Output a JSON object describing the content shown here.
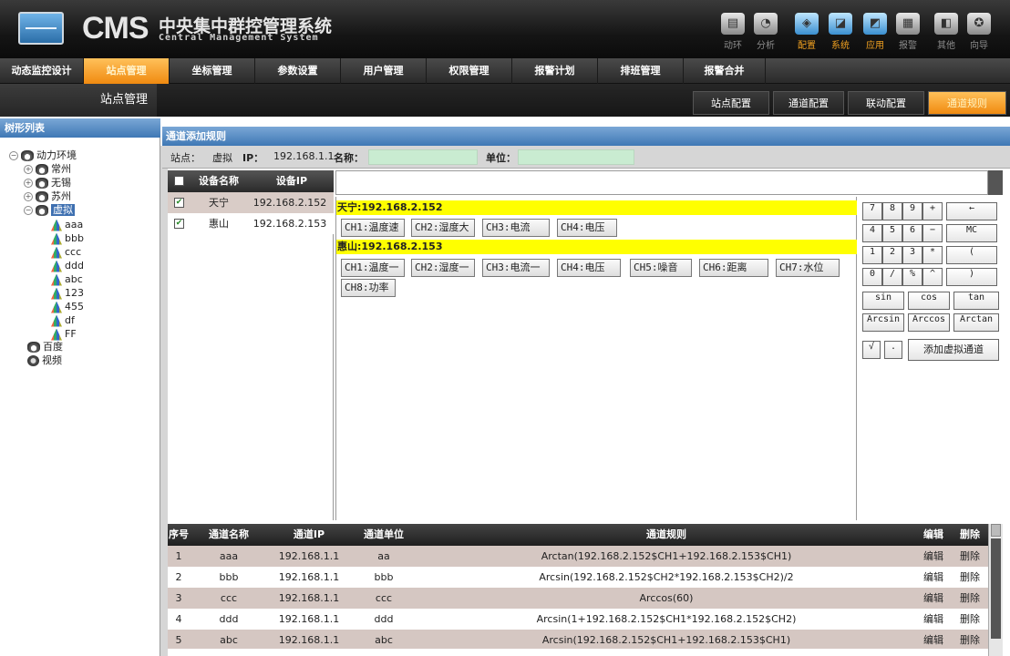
{
  "app": {
    "logo_text": "CMS",
    "title_cn": "中央集中群控管理系统",
    "title_en": "Central Management System"
  },
  "header_icons": [
    {
      "name": "env-icon",
      "label": "动环",
      "glyph": "▤"
    },
    {
      "name": "analysis-icon",
      "label": "分析",
      "glyph": "◔"
    },
    {
      "name": "config-icon",
      "label": "配置",
      "glyph": "◈",
      "active": true
    },
    {
      "name": "system-icon",
      "label": "系统",
      "glyph": "◪",
      "active": true
    },
    {
      "name": "apps-icon",
      "label": "应用",
      "glyph": "◩",
      "active": true
    },
    {
      "name": "alarm-icon",
      "label": "报警",
      "glyph": "▦"
    },
    {
      "name": "other-icon",
      "label": "其他",
      "glyph": "◧"
    },
    {
      "name": "wizard-icon",
      "label": "向导",
      "glyph": "✪"
    }
  ],
  "nav": [
    "动态监控设计",
    "站点管理",
    "坐标管理",
    "参数设置",
    "用户管理",
    "权限管理",
    "报警计划",
    "排班管理",
    "报警合并"
  ],
  "section_title": "站点管理",
  "subtabs": [
    "站点配置",
    "通道配置",
    "联动配置",
    "通道规则"
  ],
  "tree": {
    "title": "树形列表",
    "root": "动力环境",
    "cities": [
      "常州",
      "无锡",
      "苏州",
      "虚拟"
    ],
    "devices": [
      "aaa",
      "bbb",
      "ccc",
      "ddd",
      "abc",
      "123",
      "455",
      "df",
      "FF"
    ],
    "extra_site": "百度",
    "video": "视频"
  },
  "panel_title": "通道添加规则",
  "info": {
    "site_label": "站点：",
    "site_value": "虚拟",
    "ip_label": "IP：",
    "ip_value": "192.168.1.1",
    "name_label": "名称：",
    "name_value": "",
    "unit_label": "单位：",
    "unit_value": ""
  },
  "device_table": {
    "headers": [
      "设备名称",
      "设备IP"
    ],
    "rows": [
      {
        "name": "天宁",
        "ip": "192.168.2.152",
        "checked": true
      },
      {
        "name": "惠山",
        "ip": "192.168.2.153",
        "checked": true
      }
    ]
  },
  "formula_value": "",
  "channel_groups": [
    {
      "title": "天宁:192.168.2.152",
      "channels": [
        "CH1:温度速",
        "CH2:湿度大",
        "CH3:电流",
        "CH4:电压"
      ]
    },
    {
      "title": "惠山:192.168.2.153",
      "channels": [
        "CH1:温度一",
        "CH2:湿度一",
        "CH3:电流一",
        "CH4:电压",
        "CH5:噪音",
        "CH6:距离",
        "CH7:水位",
        "CH8:功率"
      ]
    }
  ],
  "calculator_keys": [
    "7",
    "8",
    "9",
    "+",
    "←",
    "4",
    "5",
    "6",
    "−",
    "MC",
    "1",
    "2",
    "3",
    "*",
    "(",
    "0",
    "/",
    "%",
    "^",
    ")",
    "sin",
    "cos",
    "tan",
    "Arcsin",
    "Arccos",
    "Arctan",
    "√",
    ".",
    "添加虚拟通道"
  ],
  "rule_table": {
    "headers": [
      "序号",
      "通道名称",
      "通道IP",
      "通道单位",
      "通道规则",
      "编辑",
      "删除"
    ],
    "rows": [
      {
        "no": "1",
        "name": "aaa",
        "ip": "192.168.1.1",
        "unit": "aa",
        "rule": "Arctan(192.168.2.152$CH1+192.168.2.153$CH1)",
        "edit": "编辑",
        "del": "删除"
      },
      {
        "no": "2",
        "name": "bbb",
        "ip": "192.168.1.1",
        "unit": "bbb",
        "rule": "Arcsin(192.168.2.152$CH2*192.168.2.153$CH2)/2",
        "edit": "编辑",
        "del": "删除"
      },
      {
        "no": "3",
        "name": "ccc",
        "ip": "192.168.1.1",
        "unit": "ccc",
        "rule": "Arccos(60)",
        "edit": "编辑",
        "del": "删除"
      },
      {
        "no": "4",
        "name": "ddd",
        "ip": "192.168.1.1",
        "unit": "ddd",
        "rule": "Arcsin(1+192.168.2.152$CH1*192.168.2.152$CH2)",
        "edit": "编辑",
        "del": "删除"
      },
      {
        "no": "5",
        "name": "abc",
        "ip": "192.168.1.1",
        "unit": "abc",
        "rule": "Arcsin(192.168.2.152$CH1+192.168.2.153$CH1)",
        "edit": "编辑",
        "del": "删除"
      }
    ]
  }
}
